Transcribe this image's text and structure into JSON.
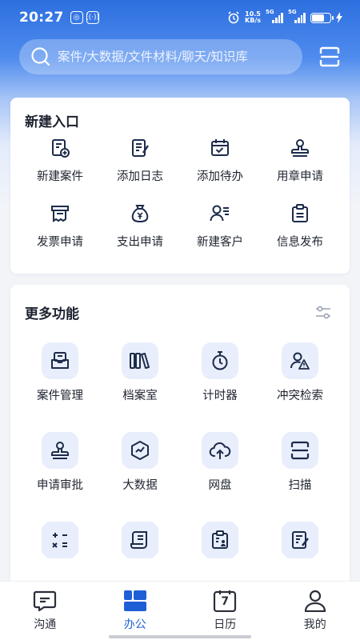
{
  "status": {
    "time": "20:27",
    "net_speed_value": "10.5",
    "net_speed_unit": "KB/s",
    "sig1": "5G",
    "sig2": "5G"
  },
  "search": {
    "placeholder": "案件/大数据/文件材料/聊天/知识库"
  },
  "entry": {
    "title": "新建入口",
    "items": [
      {
        "label": "新建案件",
        "icon": "new-case-icon"
      },
      {
        "label": "添加日志",
        "icon": "add-log-icon"
      },
      {
        "label": "添加待办",
        "icon": "add-todo-icon"
      },
      {
        "label": "用章申请",
        "icon": "seal-icon"
      },
      {
        "label": "发票申请",
        "icon": "invoice-icon"
      },
      {
        "label": "支出申请",
        "icon": "money-bag-icon"
      },
      {
        "label": "新建客户",
        "icon": "new-client-icon"
      },
      {
        "label": "信息发布",
        "icon": "clipboard-icon"
      }
    ]
  },
  "more": {
    "title": "更多功能",
    "items": [
      {
        "label": "案件管理",
        "icon": "case-tray-icon"
      },
      {
        "label": "档案室",
        "icon": "archive-books-icon"
      },
      {
        "label": "计时器",
        "icon": "stopwatch-icon"
      },
      {
        "label": "冲突检索",
        "icon": "conflict-warning-icon"
      },
      {
        "label": "申请审批",
        "icon": "stamp-icon"
      },
      {
        "label": "大数据",
        "icon": "trend-chart-icon"
      },
      {
        "label": "网盘",
        "icon": "cloud-upload-icon"
      },
      {
        "label": "扫描",
        "icon": "scan-icon"
      },
      {
        "label": "",
        "icon": "calculator-icon"
      },
      {
        "label": "",
        "icon": "scroll-icon"
      },
      {
        "label": "",
        "icon": "clipboard-person-icon"
      },
      {
        "label": "",
        "icon": "document-edit-icon"
      }
    ]
  },
  "tabs": [
    {
      "label": "沟通",
      "icon": "chat-icon"
    },
    {
      "label": "办公",
      "icon": "office-grid-icon"
    },
    {
      "label": "日历",
      "icon": "calendar-icon",
      "day": "7"
    },
    {
      "label": "我的",
      "icon": "profile-icon"
    }
  ],
  "colors": {
    "accent": "#1f5fd6",
    "icon_dark": "#1d2b4a",
    "icon_bg": "#e8eefb"
  }
}
